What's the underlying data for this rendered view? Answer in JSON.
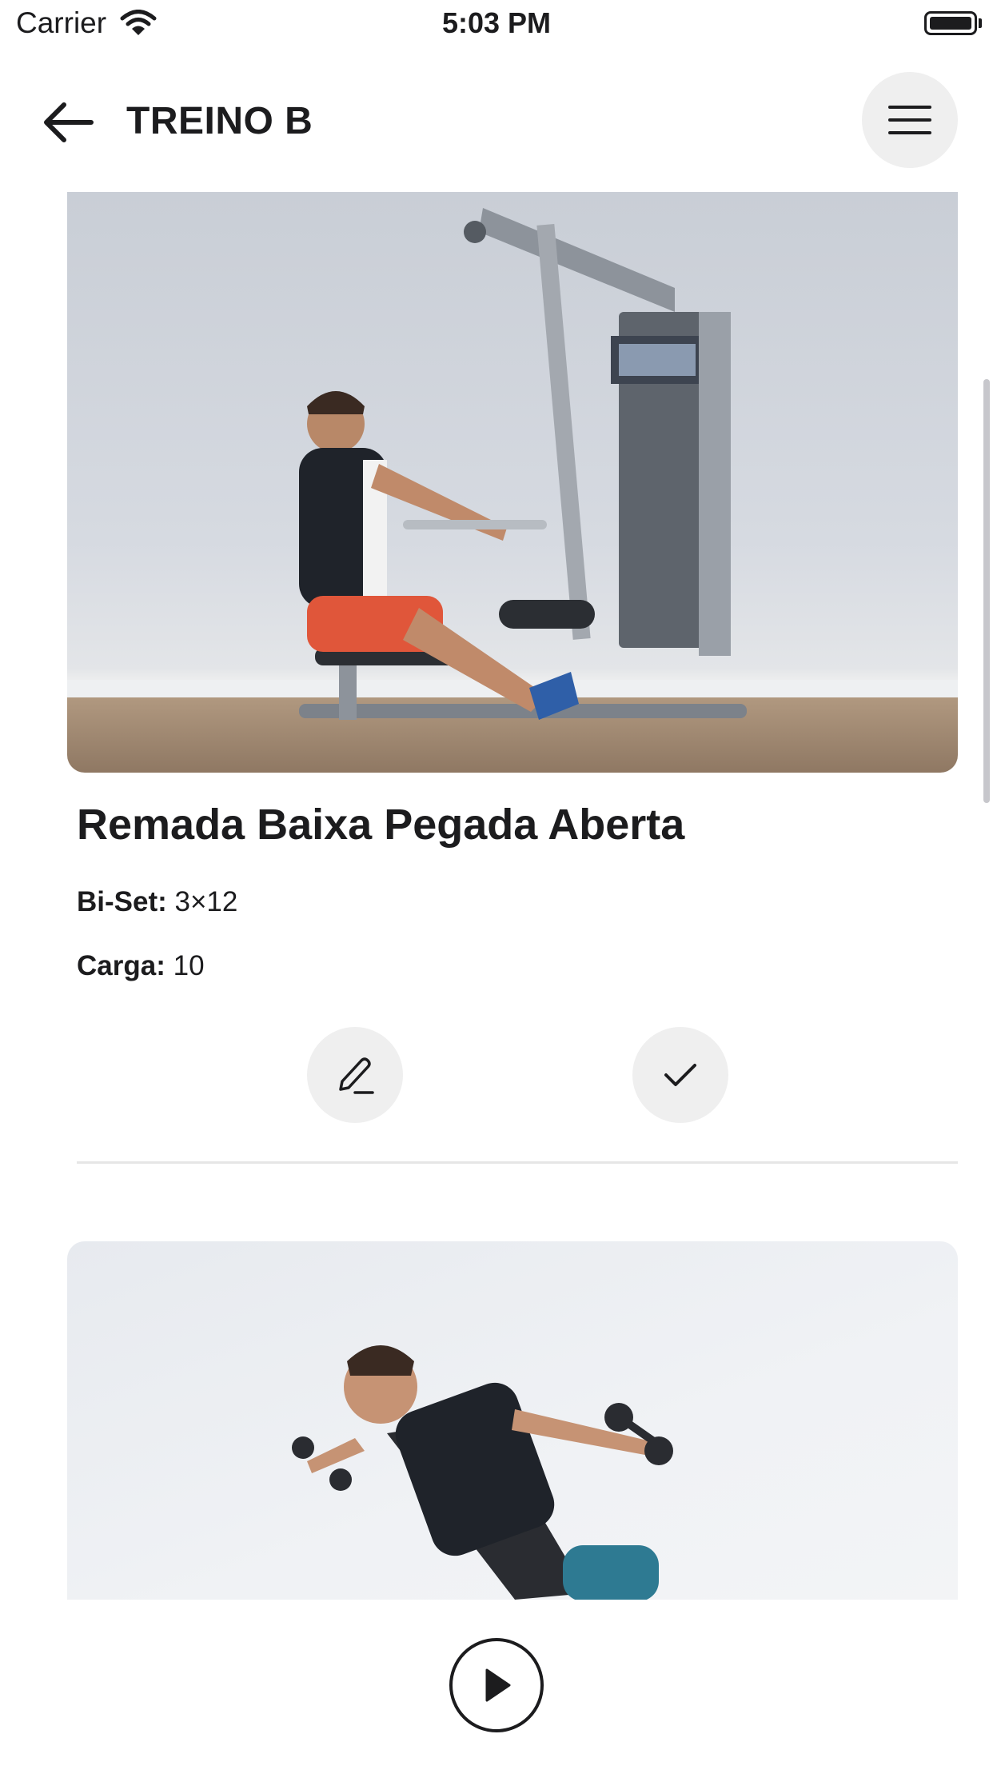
{
  "status_bar": {
    "carrier": "Carrier",
    "time": "5:03 PM"
  },
  "header": {
    "title": "TREINO B"
  },
  "exercise": {
    "name": "Remada Baixa Pegada Aberta",
    "set_label": "Bi-Set:",
    "set_value": "3×12",
    "load_label": "Carga:",
    "load_value": "10"
  },
  "icons": {
    "back": "arrow-left-icon",
    "menu": "hamburger-menu-icon",
    "edit": "pencil-icon",
    "check": "checkmark-icon",
    "play": "play-icon"
  }
}
